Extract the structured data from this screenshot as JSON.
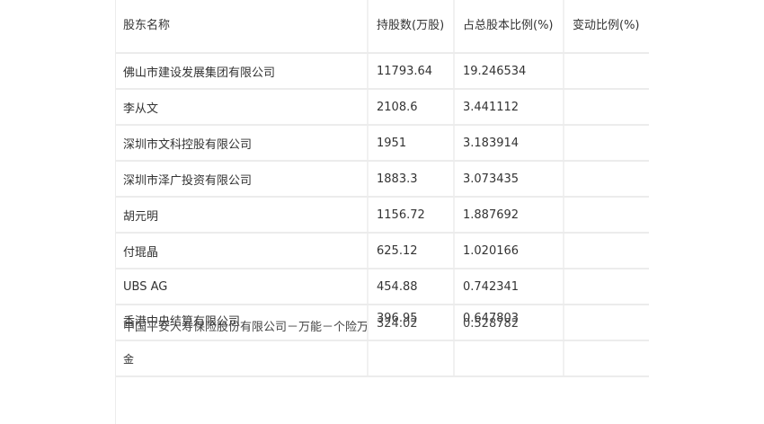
{
  "table": {
    "headers": [
      "股东名称",
      "持股数(万股)",
      "占总股本比例(%)",
      "变动比例(%)"
    ],
    "rows": [
      {
        "name": "佛山市建设发展集团有限公司",
        "shares": "11793.64",
        "ratio": "19.246534",
        "change": ""
      },
      {
        "name": "李从文",
        "shares": "2108.6",
        "ratio": "3.441112",
        "change": ""
      },
      {
        "name": "深圳市文科控股有限公司",
        "shares": "1951",
        "ratio": "3.183914",
        "change": ""
      },
      {
        "name": "深圳市泽广投资有限公司",
        "shares": "1883.3",
        "ratio": "3.073435",
        "change": ""
      },
      {
        "name": "胡元明",
        "shares": "1156.72",
        "ratio": "1.887692",
        "change": ""
      },
      {
        "name": "付琨晶",
        "shares": "625.12",
        "ratio": "1.020166",
        "change": ""
      },
      {
        "name": "UBS AG",
        "shares": "454.88",
        "ratio": "0.742341",
        "change": ""
      }
    ],
    "overlap": {
      "row_a": {
        "name": "香港中央结算有限公司",
        "shares": "396.95",
        "ratio": "0.647803"
      },
      "row_b": {
        "name": "中国平安人寿保险股份有限公司－万能－个险万能",
        "shares": "324.02",
        "ratio": "0.528782"
      },
      "overflow_char": "金"
    }
  }
}
